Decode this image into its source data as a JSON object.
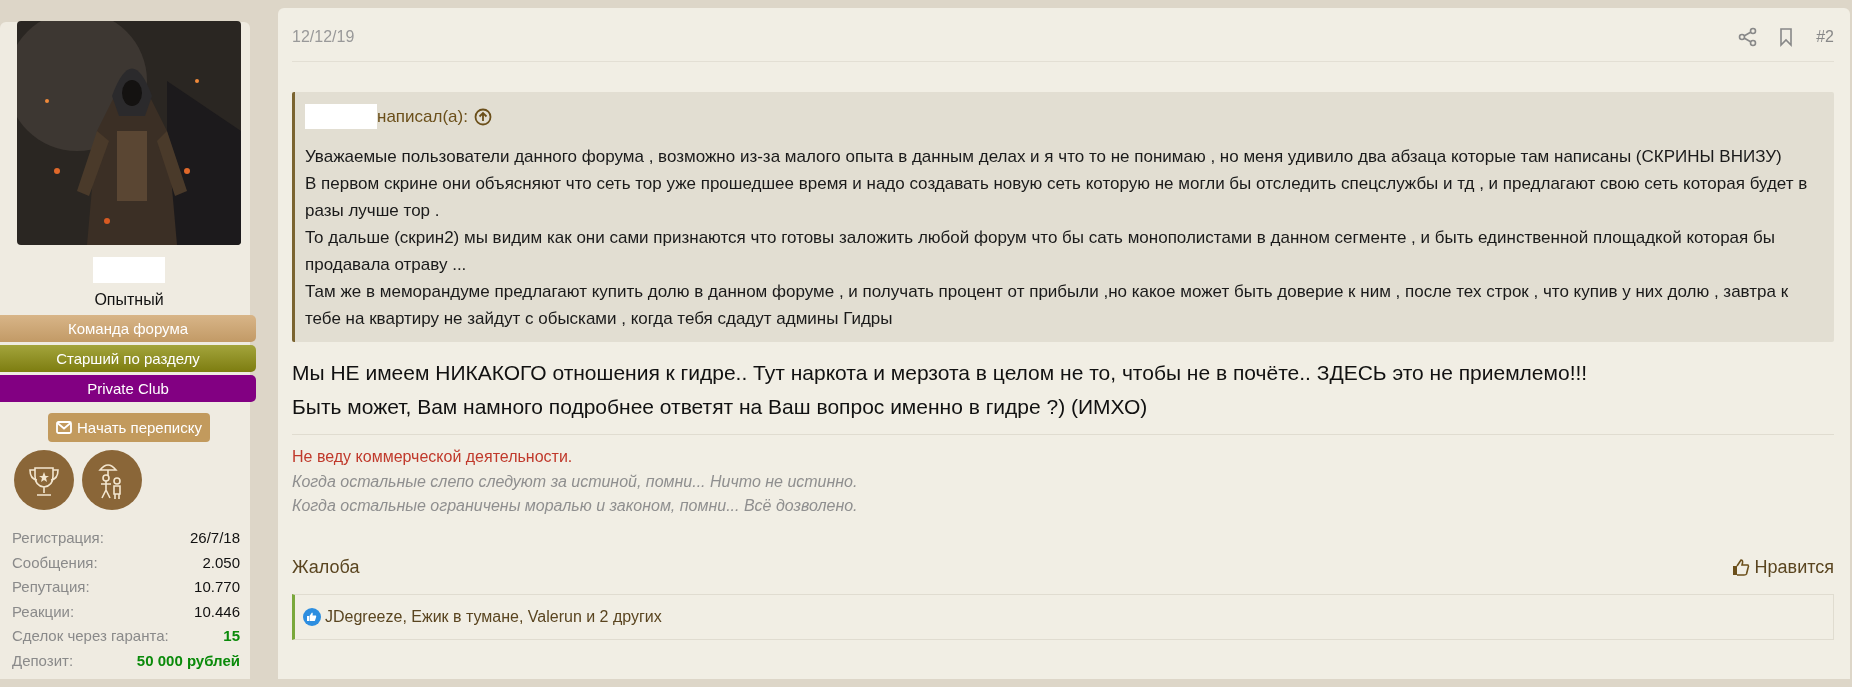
{
  "author": {
    "rank": "Опытный",
    "banners": [
      {
        "label": "Команда форума",
        "kind": "tan"
      },
      {
        "label": "Старший по разделу",
        "kind": "olive"
      },
      {
        "label": "Private Club",
        "kind": "purple"
      }
    ],
    "message_button": "Начать переписку",
    "stats": [
      {
        "label": "Регистрация:",
        "value": "26/7/18",
        "kind": "plain"
      },
      {
        "label": "Сообщения:",
        "value": "2.050",
        "kind": "plain"
      },
      {
        "label": "Репутация:",
        "value": "10.770",
        "kind": "plain"
      },
      {
        "label": "Реакции:",
        "value": "10.446",
        "kind": "plain"
      },
      {
        "label": "Сделок через гаранта:",
        "value": "15",
        "kind": "green"
      },
      {
        "label": "Депозит:",
        "value": "50 000 рублей",
        "kind": "green"
      }
    ]
  },
  "post": {
    "date": "12/12/19",
    "number": "#2",
    "quote": {
      "wrote": "написал(а):",
      "paragraphs": [
        "Уважаемые пользователи данного форума , возможно из-за малого опыта в данным делах и я что то не понимаю , но меня удивило два абзаца которые там написаны (СКРИНЫ ВНИЗУ)",
        "В первом скрине они объясняют что сеть тор уже прошедшее время и надо создавать новую сеть которую не могли бы отследить спецслужбы и тд , и предлагают свою сеть которая будет в разы лучше тор .",
        "То дальше (скрин2) мы видим как они сами признаются что готовы заложить любой форум что бы сать монополистами в данном сегменте , и быть единственной площадкой которая бы продавала отраву ...",
        "Там же в меморандуме предлагают купить долю в данном форуме , и получать процент от прибыли ,но какое может быть доверие к ним , после тех строк , что купив у них долю , завтра к тебе на квартиру не зайдут с обысками , когда тебя сдадут админы Гидры"
      ]
    },
    "body": [
      "Мы НЕ имеем НИКАКОГО отношения к гидре.. Тут наркота и мерзота в целом не то, чтобы не в почёте.. ЗДЕСЬ это не приемлемо!!!",
      "Быть может, Вам намного подробнее ответят на Ваш вопрос именно в гидре ?) (ИМХО)"
    ],
    "signature": [
      {
        "text": "Не веду коммерческой деятельности.",
        "kind": "notice"
      },
      {
        "text": "Когда остальные слепо следуют за истиной, помни... Ничто не истинно.",
        "kind": "quote"
      },
      {
        "text": "Когда остальные ограничены моралью и законом, помни... Всё дозволено.",
        "kind": "quote"
      }
    ],
    "report": "Жалоба",
    "like": "Нравится",
    "reactions": "JDegreeze, Ежик в тумане, Valerun и 2 других"
  }
}
